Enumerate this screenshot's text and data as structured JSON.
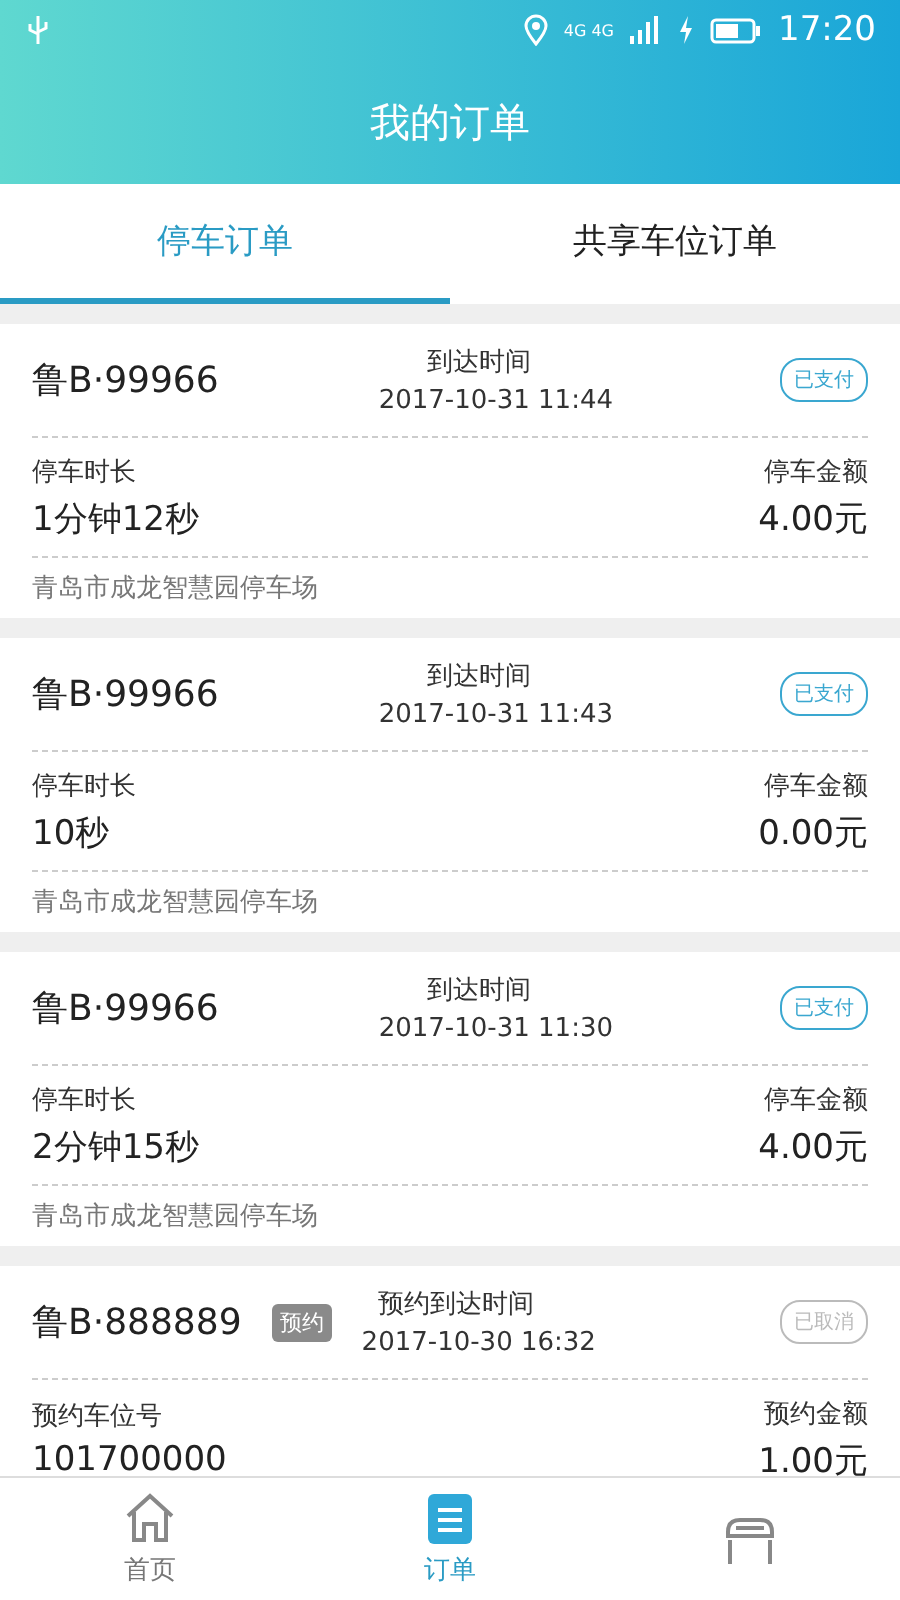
{
  "status_bar": {
    "time": "17:20",
    "network": "4G 4G"
  },
  "title": "我的订单",
  "tabs": [
    {
      "label": "停车订单",
      "selected": true
    },
    {
      "label": "共享车位订单",
      "selected": false
    }
  ],
  "orders": [
    {
      "plate": "鲁B·99966",
      "time_label": "到达时间",
      "time": "2017-10-31 11:44",
      "status": "已支付",
      "cancelled": false,
      "left_label": "停车时长",
      "left_value": "1分钟12秒",
      "right_label": "停车金额",
      "right_value": "4.00元",
      "location": "青岛市成龙智慧园停车场"
    },
    {
      "plate": "鲁B·99966",
      "time_label": "到达时间",
      "time": "2017-10-31 11:43",
      "status": "已支付",
      "cancelled": false,
      "left_label": "停车时长",
      "left_value": "10秒",
      "right_label": "停车金额",
      "right_value": "0.00元",
      "location": "青岛市成龙智慧园停车场"
    },
    {
      "plate": "鲁B·99966",
      "time_label": "到达时间",
      "time": "2017-10-31 11:30",
      "status": "已支付",
      "cancelled": false,
      "left_label": "停车时长",
      "left_value": "2分钟15秒",
      "right_label": "停车金额",
      "right_value": "4.00元",
      "location": "青岛市成龙智慧园停车场"
    },
    {
      "plate": "鲁B·888889",
      "tag": "预约",
      "time_label": "预约到达时间",
      "time": "2017-10-30 16:32",
      "status": "已取消",
      "cancelled": true,
      "left_label": "预约车位号",
      "left_value": "101700000",
      "right_label": "预约金额",
      "right_value": "1.00元"
    }
  ],
  "nav": [
    {
      "label": "首页",
      "kind": "home",
      "selected": false
    },
    {
      "label": "订单",
      "kind": "orders",
      "selected": true
    },
    {
      "kind": "shop",
      "selected": false
    }
  ]
}
